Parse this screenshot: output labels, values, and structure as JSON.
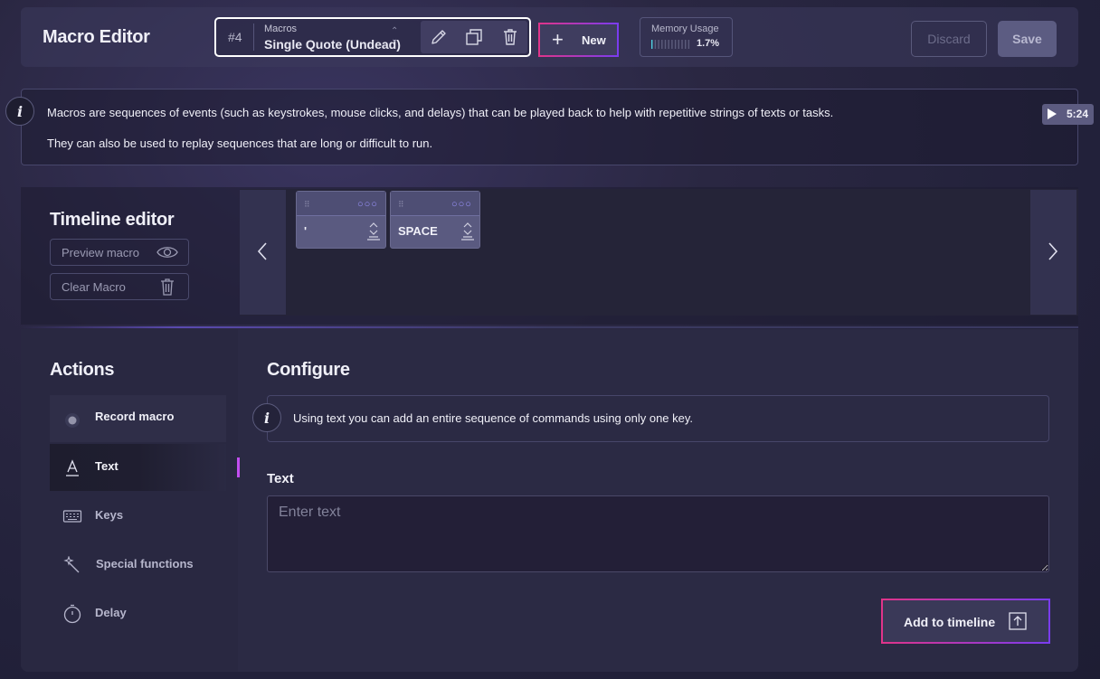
{
  "header": {
    "title": "Macro Editor",
    "macro_number": "#4",
    "macro_list_label": "Macros",
    "macro_name": "Single Quote (Undead)",
    "new_label": "New",
    "memory_label": "Memory Usage",
    "memory_value": "1.7%",
    "memory_fraction": 0.017,
    "discard_label": "Discard",
    "save_label": "Save"
  },
  "info": {
    "line1": "Macros are sequences of events (such as keystrokes, mouse clicks, and delays) that can be played back to help with repetitive strings of texts or tasks.",
    "line2": "They can also be used to replay sequences that are long or difficult to run.",
    "video_time": "5:24"
  },
  "timeline": {
    "title": "Timeline editor",
    "preview_label": "Preview macro",
    "clear_label": "Clear Macro",
    "items": [
      {
        "label": "'"
      },
      {
        "label": "SPACE"
      }
    ]
  },
  "actions": {
    "title": "Actions",
    "items": [
      {
        "label": "Record macro",
        "icon": "record-icon"
      },
      {
        "label": "Text",
        "icon": "text-icon"
      },
      {
        "label": "Keys",
        "icon": "keyboard-icon"
      },
      {
        "label": "Special functions",
        "icon": "magic-wand-icon"
      },
      {
        "label": "Delay",
        "icon": "timer-icon"
      }
    ],
    "active": "Text"
  },
  "configure": {
    "title": "Configure",
    "info_text": "Using text you can add an entire sequence of commands using only one key.",
    "text_label": "Text",
    "text_value": "",
    "text_placeholder": "Enter text",
    "add_label": "Add to timeline"
  },
  "colors": {
    "accent_pink": "#e0348a",
    "accent_purple": "#7a3cf0",
    "active_marker": "#c24ef0"
  }
}
